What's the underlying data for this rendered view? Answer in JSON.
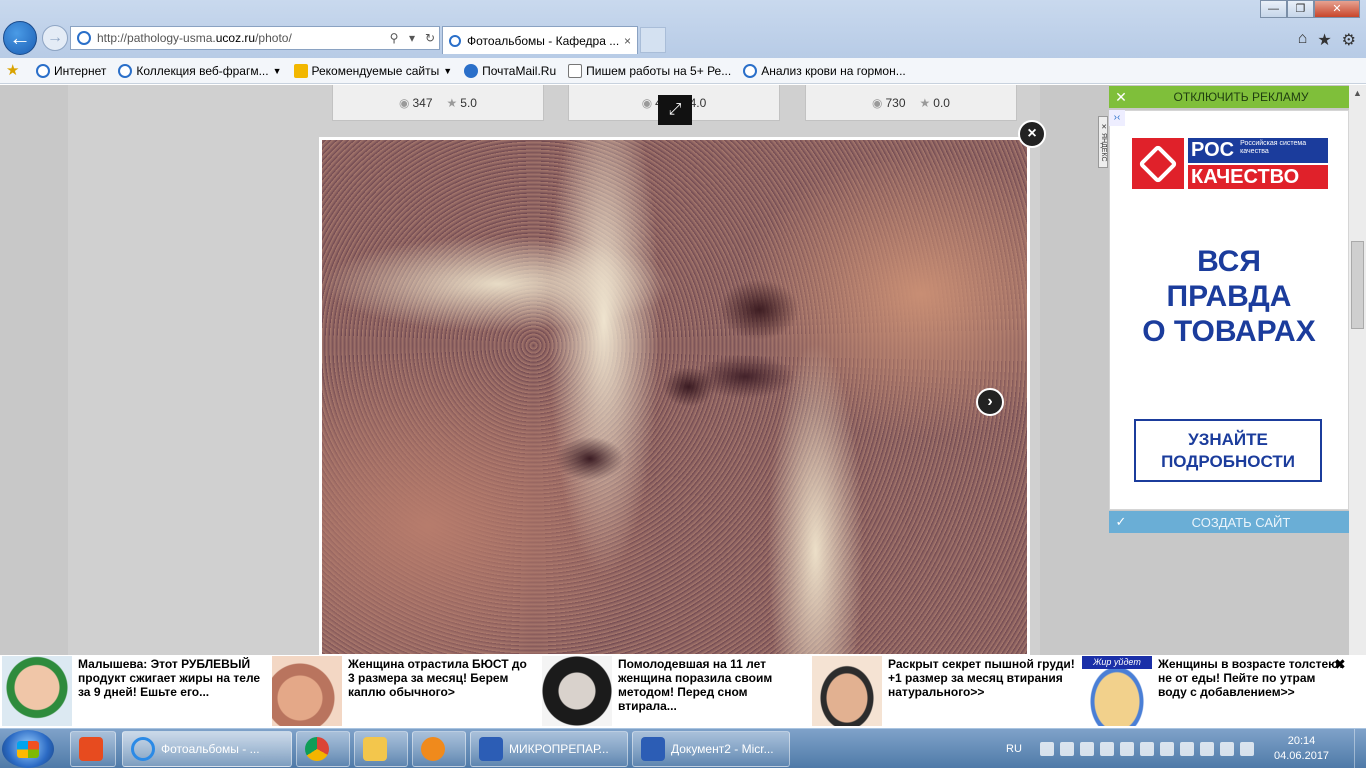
{
  "browser": {
    "url_prefix": "http://pathology-usma.",
    "url_domain": "ucoz.ru",
    "url_suffix": "/photo/",
    "tab_title": "Фотоальбомы - Кафедра ...",
    "tab_close": "×",
    "back": "←",
    "forward": "→",
    "search_btn": "⚲",
    "dropdown_btn": "▾",
    "refresh_btn": "↻",
    "window_minimize": "—",
    "window_restore": "❐",
    "window_close": "✕",
    "home_icon": "⌂",
    "fav_icon": "★",
    "settings_icon": "⚙"
  },
  "favorites": [
    {
      "label": "Интернет",
      "icon": "e-icon"
    },
    {
      "label": "Коллекция веб-фрагм...",
      "icon": "e-icon",
      "dropdown": true
    },
    {
      "label": "Рекомендуемые сайты",
      "icon": "bing-icon",
      "dropdown": true
    },
    {
      "label": "ПочтаMail.Ru",
      "icon": "mail-icon"
    },
    {
      "label": "Пишем работы на 5+   Ре...",
      "icon": "doc-icon"
    },
    {
      "label": "Анализ крови на гормон...",
      "icon": "e-icon"
    }
  ],
  "gallery": {
    "cards": [
      {
        "views": "347",
        "rating": "5.0"
      },
      {
        "views": "4",
        "rating": "4.0"
      },
      {
        "views": "730",
        "rating": "0.0"
      }
    ],
    "expand_icon": "⤢",
    "close_icon": "×",
    "next_icon": "›"
  },
  "ad": {
    "disable_label": "ОТКЛЮЧИТЬ РЕКЛАМУ",
    "disable_check": "✕",
    "side_tag": "✕ ЯНДЕКС",
    "info_icon": "›‹",
    "logo_ros": "РОС",
    "logo_small": "Российская система качества",
    "logo_kach": "КАЧЕСТВО",
    "headline_1": "ВСЯ",
    "headline_2": "ПРАВДА",
    "headline_3": "О ТОВАРАХ",
    "cta_1": "УЗНАЙТЕ",
    "cta_2": "ПОДРОБНОСТИ",
    "create_label": "СОЗДАТЬ САЙТ",
    "create_check": "✓"
  },
  "teasers": [
    {
      "text": "Малышева: Этот РУБЛЕВЫЙ продукт сжигает жиры на теле за 9 дней! Ешьте его..."
    },
    {
      "text": "Женщина отрастила БЮСТ до 3 размера за месяц! Берем каплю обычного>"
    },
    {
      "text": "Помолодевшая на 11 лет женщина поразила своим методом! Перед сном втирала..."
    },
    {
      "text": "Раскрыт секрет пышной груди! +1 размер за месяц втирания натурального>>"
    },
    {
      "text": "Женщины в возрасте толстеют не от еды! Пейте по утрам воду с добавлением>>",
      "badge": "Жир уйдет"
    }
  ],
  "teaser_close": "✖",
  "taskbar": {
    "items": [
      {
        "label": "",
        "icon": "red-app-icon"
      },
      {
        "label": "Фотоальбомы - ...",
        "icon": "ie-icon",
        "active": true
      },
      {
        "label": "",
        "icon": "chrome-icon"
      },
      {
        "label": "",
        "icon": "folder-icon"
      },
      {
        "label": "",
        "icon": "media-icon"
      },
      {
        "label": "МИКРОПРЕПАР...",
        "icon": "word-icon"
      },
      {
        "label": "Документ2 - Micr...",
        "icon": "word-icon"
      }
    ],
    "lang": "RU",
    "time": "20:14",
    "date": "04.06.2017"
  }
}
